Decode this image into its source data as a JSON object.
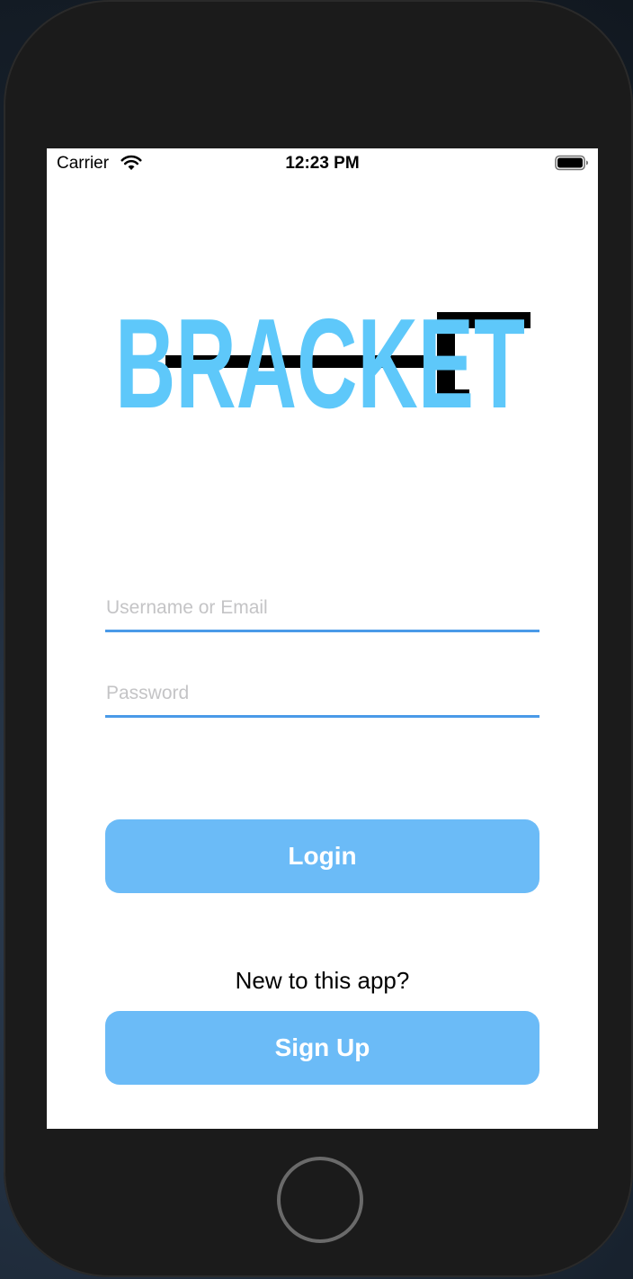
{
  "status_bar": {
    "carrier": "Carrier",
    "time": "12:23 PM",
    "icons": [
      "wifi-icon",
      "battery-icon"
    ]
  },
  "logo": {
    "text": "BRACKET",
    "colors": {
      "letters": "#5ec8fa",
      "bracket": "#000000"
    }
  },
  "form": {
    "username_placeholder": "Username or Email",
    "password_placeholder": "Password",
    "login_label": "Login"
  },
  "signup": {
    "prompt": "New to this app?",
    "button_label": "Sign Up"
  },
  "colors": {
    "accent": "#6bbbf7",
    "underline": "#4a9ae8",
    "placeholder": "#c4c4c6",
    "device": "#1b1b1b"
  }
}
